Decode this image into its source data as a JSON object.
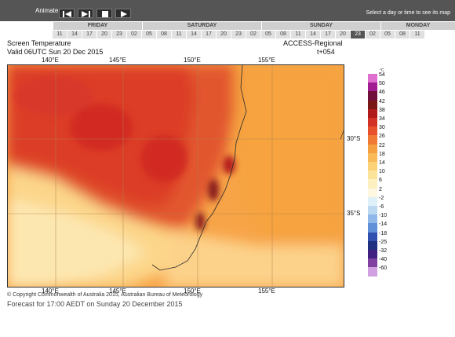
{
  "toolbar": {
    "animate_label": "Animate",
    "hint": "Select a day or time to see its map",
    "buttons": [
      "step-back",
      "step-forward",
      "stop",
      "play"
    ]
  },
  "days": [
    "FRIDAY",
    "SATURDAY",
    "SUNDAY",
    "MONDAY"
  ],
  "hours": [
    "11",
    "14",
    "17",
    "20",
    "23",
    "02",
    "05",
    "08",
    "11",
    "14",
    "17",
    "20",
    "23",
    "02",
    "05",
    "08",
    "11",
    "14",
    "17",
    "20",
    "23",
    "02",
    "05",
    "08",
    "11"
  ],
  "selected_hour_index": 20,
  "map": {
    "title": "Screen Temperature",
    "valid": "Valid 06UTC Sun 20 Dec 2015",
    "model": "ACCESS-Regional",
    "lead": "t+054",
    "lon_labels": [
      "140°E",
      "145°E",
      "150°E",
      "155°E"
    ],
    "lat_labels": [
      "30°S",
      "35°S"
    ]
  },
  "colorbar": {
    "unit": "°C",
    "labels": [
      "54",
      "50",
      "46",
      "42",
      "38",
      "34",
      "30",
      "26",
      "22",
      "18",
      "14",
      "10",
      "6",
      "2",
      "-2",
      "-6",
      "-10",
      "-14",
      "-18",
      "-25",
      "-32",
      "-40",
      "-60"
    ],
    "colors": [
      "#e070d0",
      "#a01c90",
      "#70103a",
      "#7a1818",
      "#b01a1a",
      "#d23226",
      "#e8502c",
      "#f07a34",
      "#f5a040",
      "#f8bb58",
      "#fbd278",
      "#fce39a",
      "#fdf0c0",
      "#fff8e0",
      "#e0f0f8",
      "#bcd8f0",
      "#90b8e8",
      "#6090d8",
      "#3050b0",
      "#203080",
      "#402080",
      "#8040a0",
      "#d0a0e0"
    ]
  },
  "copyright": "© Copyright Commonwealth of Australia 2015, Australian Bureau of Meteorology",
  "forecast": "Forecast for 17:00 AEDT on Sunday 20 December 2015"
}
